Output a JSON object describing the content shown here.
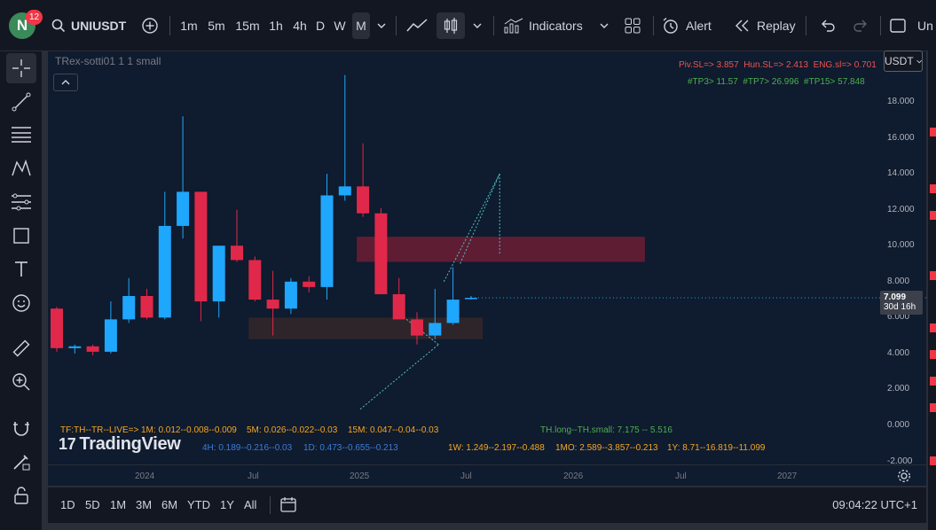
{
  "header": {
    "avatar_letter": "N",
    "notification_count": "12",
    "symbol": "UNIUSDT",
    "timeframes": [
      "1m",
      "5m",
      "15m",
      "1h",
      "4h",
      "D",
      "W",
      "M"
    ],
    "active_timeframe": "M",
    "indicators_label": "Indicators",
    "alert_label": "Alert",
    "replay_label": "Replay",
    "truncated_right": "Un"
  },
  "chart": {
    "legend": "TRex-sotti01 1 1 small",
    "currency_button": "USDT",
    "sl_line": {
      "piv": "Piv.SL=> 3.857",
      "hun": "Hun.SL=> 2.413",
      "eng": "ENG.sl=> 0.701"
    },
    "tp_line": {
      "tp3": "#TP3> 11.57",
      "tp7": "#TP7> 26.996",
      "tp15": "#TP15> 57.848"
    },
    "price_ticks": [
      "18.000",
      "16.000",
      "14.000",
      "12.000",
      "10.000",
      "8.000",
      "6.000",
      "4.000",
      "2.000",
      "0.000",
      "-2.000"
    ],
    "current_price": "7.099",
    "countdown": "30d 16h",
    "time_ticks": [
      "2024",
      "Jul",
      "2025",
      "Jul",
      "2026",
      "Jul",
      "2027"
    ],
    "info": {
      "tf_label": "TF:TH--TR--LIVE=>",
      "m1": "1M: 0.012--0.008--0.009",
      "m5": "5M: 0.026--0.022--0.03",
      "m15": "15M: 0.047--0.04--0.03",
      "th": "TH.long--TH.small: 7.175 -- 5.516",
      "h4": "4H: 0.189--0.216--0.03",
      "d1": "1D: 0.473--0.655--0.213",
      "w1": "1W: 1.249--2.197--0.488",
      "mo": "1MO: 2.589--3.857--0.213",
      "y1": "1Y: 8.71--16.819--11.099"
    },
    "logo_text": "TradingView"
  },
  "bottom": {
    "ranges": [
      "1D",
      "5D",
      "1M",
      "3M",
      "6M",
      "YTD",
      "1Y",
      "All"
    ],
    "clock": "09:04:22 UTC+1"
  },
  "colors": {
    "up": "#1ea7fd",
    "down": "#e0294a",
    "info_orange": "#f5a623",
    "info_blue": "#3d7dd8",
    "info_green": "#4caf50",
    "sl_red": "#ef5350",
    "tp_green": "#4caf50"
  },
  "chart_data": {
    "type": "candlestick",
    "interval": "monthly",
    "ylim": [
      -2,
      20
    ],
    "candles": [
      {
        "o": 6.5,
        "h": 6.6,
        "l": 4.1,
        "c": 4.3
      },
      {
        "o": 4.3,
        "h": 4.5,
        "l": 4.0,
        "c": 4.4
      },
      {
        "o": 4.4,
        "h": 4.5,
        "l": 3.9,
        "c": 4.1
      },
      {
        "o": 4.1,
        "h": 6.9,
        "l": 4.0,
        "c": 5.9
      },
      {
        "o": 5.9,
        "h": 8.2,
        "l": 5.7,
        "c": 7.2
      },
      {
        "o": 7.2,
        "h": 7.6,
        "l": 5.9,
        "c": 6.0
      },
      {
        "o": 6.0,
        "h": 13.0,
        "l": 5.9,
        "c": 11.1
      },
      {
        "o": 11.1,
        "h": 17.2,
        "l": 10.4,
        "c": 13.0
      },
      {
        "o": 13.0,
        "h": 13.0,
        "l": 5.8,
        "c": 6.9
      },
      {
        "o": 6.9,
        "h": 9.9,
        "l": 6.0,
        "c": 10.0
      },
      {
        "o": 10.0,
        "h": 12.0,
        "l": 9.1,
        "c": 9.2
      },
      {
        "o": 9.2,
        "h": 9.4,
        "l": 6.9,
        "c": 7.0
      },
      {
        "o": 7.0,
        "h": 8.6,
        "l": 5.0,
        "c": 6.5
      },
      {
        "o": 6.5,
        "h": 8.2,
        "l": 6.2,
        "c": 8.0
      },
      {
        "o": 8.0,
        "h": 8.3,
        "l": 7.4,
        "c": 7.7
      },
      {
        "o": 7.7,
        "h": 14.0,
        "l": 7.0,
        "c": 12.8
      },
      {
        "o": 12.8,
        "h": 19.5,
        "l": 12.5,
        "c": 13.3
      },
      {
        "o": 13.3,
        "h": 15.7,
        "l": 11.6,
        "c": 11.8
      },
      {
        "o": 11.8,
        "h": 12.1,
        "l": 9.8,
        "c": 7.3
      },
      {
        "o": 7.3,
        "h": 8.2,
        "l": 5.9,
        "c": 5.9
      },
      {
        "o": 5.9,
        "h": 6.3,
        "l": 4.5,
        "c": 5.0
      },
      {
        "o": 5.0,
        "h": 7.6,
        "l": 4.8,
        "c": 5.7
      },
      {
        "o": 5.7,
        "h": 8.8,
        "l": 5.6,
        "c": 7.0
      },
      {
        "o": 7.1,
        "h": 7.2,
        "l": 7.0,
        "c": 7.1
      }
    ],
    "zones": [
      {
        "from_index": 17,
        "to_index": 33,
        "top": 10.5,
        "bottom": 9.1,
        "color": "#7a1f35"
      },
      {
        "from_index": 11,
        "to_index": 24,
        "top": 6.0,
        "bottom": 4.8,
        "color": "#3a2a2a"
      }
    ]
  }
}
